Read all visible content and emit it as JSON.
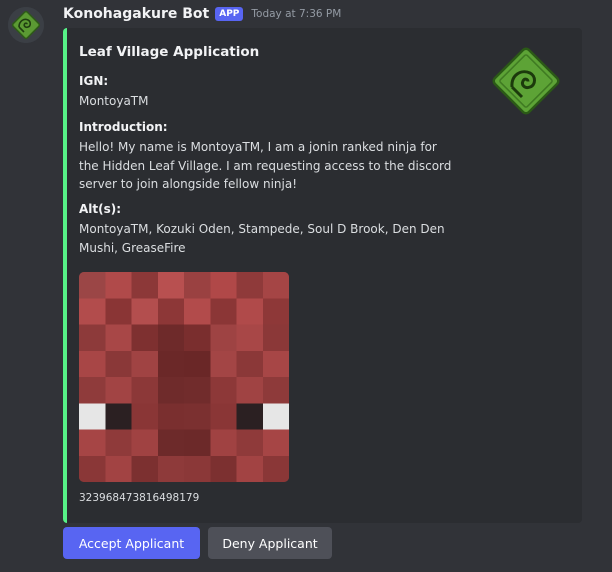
{
  "message": {
    "author": "Konohagakure Bot",
    "badge": "APP",
    "timestamp": "Today at 7:36 PM"
  },
  "embed": {
    "title": "Leaf Village Application",
    "accent_color": "#57f287",
    "fields": [
      {
        "name": "IGN:",
        "value": "MontoyaTM"
      },
      {
        "name": "Introduction:",
        "value": "Hello! My name is MontoyaTM, I am a jonin ranked ninja for the Hidden Leaf Village. I am requesting access to the discord server to join alongside fellow ninja!"
      },
      {
        "name": "Alt(s):",
        "value": "MontoyaTM, Kozuki Oden, Stampede, Soul D Brook, Den Den Mushi, GreaseFire"
      }
    ],
    "image_icon": "minecraft-skin-face-image",
    "thumbnail_icon": "leaf-village-emblem-icon",
    "footer": "323968473816498179"
  },
  "buttons": {
    "accept": "Accept Applicant",
    "deny": "Deny Applicant"
  },
  "colors": {
    "accept_button": "#5865f2",
    "deny_button": "#4e5058",
    "background": "#313338",
    "embed_background": "#2b2d31"
  }
}
